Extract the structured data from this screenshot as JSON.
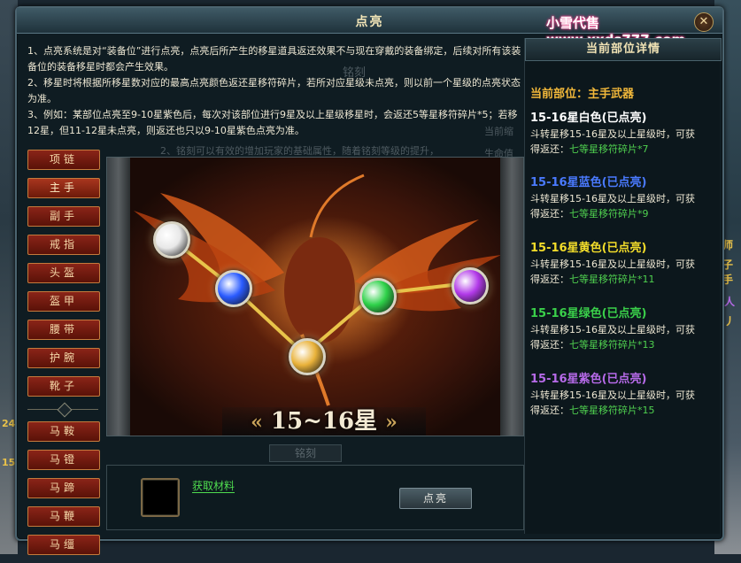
{
  "window": {
    "title": "点亮",
    "watermark": "小雪代售www.xxds777.com",
    "close_glyph": "✕"
  },
  "description": [
    "1、点亮系统是对“装备位”进行点亮，点亮后所产生的移星道具返还效果不与现在穿戴的装备绑定，后续对所有该装备位的装备移星时都会产生效果。",
    "2、移星时将根据所移星数对应的最高点亮颜色返还星移符碎片，若所对应星级未点亮，则以前一个星级的点亮状态为准。",
    "3、例如：某部位点亮至9-10星紫色后，每次对该部位进行9星及以上星级移星时，会返还5等星移符碎片*5；若移12星，但11-12星未点亮，则返还也只以9-10星紫色点亮为准。"
  ],
  "ghost_text": {
    "engrave_top": "铭刻",
    "engrave_line": "2、铭刻可以有效的增加玩家的基础属性，随着铭刻等级的提升，",
    "current_prev": "当前缩",
    "hp_label": "生命值",
    "engrave_tab": "铭刻"
  },
  "slots": {
    "group1": [
      "项链",
      "主手",
      "副手",
      "戒指",
      "头盔",
      "盔甲",
      "腰带",
      "护腕",
      "靴子"
    ],
    "group2": [
      "马鞍",
      "马镫",
      "马蹄",
      "马鞭",
      "马缰"
    ],
    "active": "主手"
  },
  "art": {
    "level_label": "15~16星",
    "prev_glyph": "«",
    "next_glyph": "»",
    "gems": [
      {
        "name": "white",
        "color": "#e8e8e8"
      },
      {
        "name": "blue",
        "color": "#2a5bff"
      },
      {
        "name": "gold",
        "color": "#e9b23a"
      },
      {
        "name": "green",
        "color": "#2fd24a"
      },
      {
        "name": "purple",
        "color": "#b23ae9"
      }
    ]
  },
  "bottom": {
    "material_link": "获取材料",
    "light_button": "点亮"
  },
  "detail": {
    "header": "当前部位详情",
    "slot_label": "当前部位：主手武器",
    "tiers": [
      {
        "title": "15-16星白色(已点亮)",
        "color": "#ffffff",
        "desc": "斗转星移15-16星及以上星级时，可获",
        "reward_prefix": "得返还：",
        "reward": "七等星移符碎片*7"
      },
      {
        "title": "15-16星蓝色(已点亮)",
        "color": "#4a7aff",
        "desc": "斗转星移15-16星及以上星级时，可获",
        "reward_prefix": "得返还：",
        "reward": "七等星移符碎片*9"
      },
      {
        "title": "15-16星黄色(已点亮)",
        "color": "#f2dc2a",
        "desc": "斗转星移15-16星及以上星级时，可获",
        "reward_prefix": "得返还：",
        "reward": "七等星移符碎片*11"
      },
      {
        "title": "15-16星绿色(已点亮)",
        "color": "#3ad04a",
        "desc": "斗转星移15-16星及以上星级时，可获",
        "reward_prefix": "得返还：",
        "reward": "七等星移符碎片*13"
      },
      {
        "title": "15-16星紫色(已点亮)",
        "color": "#b66ae8",
        "desc": "斗转星移15-16星及以上星级时，可获",
        "reward_prefix": "得返还：",
        "reward": "七等星移符碎片*15"
      }
    ]
  },
  "right_edge": {
    "frag1": "师",
    "frag2": "子手",
    "frag3": "人",
    "frag4": "丿"
  },
  "left_edge": {
    "frag1": "24",
    "frag2": "15"
  }
}
